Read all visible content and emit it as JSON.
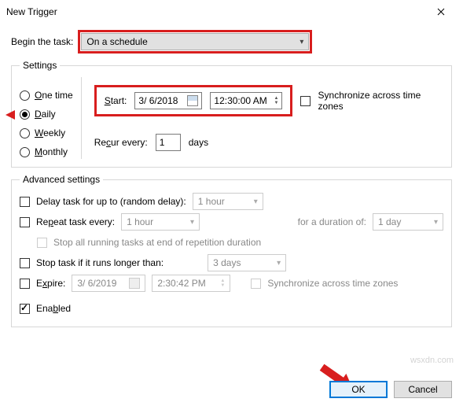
{
  "titlebar": {
    "title": "New Trigger"
  },
  "begin": {
    "label": "Begin the task:",
    "selected": "On a schedule"
  },
  "settings": {
    "legend": "Settings",
    "freq": {
      "onetime": "One time",
      "daily": "Daily",
      "weekly": "Weekly",
      "monthly": "Monthly",
      "selected": "daily"
    },
    "start": {
      "label": "Start:",
      "date": "3/ 6/2018",
      "time": "12:30:00 AM"
    },
    "sync": "Synchronize across time zones",
    "recur": {
      "label": "Recur every:",
      "value": "1",
      "unit": "days"
    }
  },
  "advanced": {
    "legend": "Advanced settings",
    "delay": {
      "label": "Delay task for up to (random delay):",
      "value": "1 hour"
    },
    "repeat": {
      "label": "Repeat task every:",
      "value": "1 hour",
      "duration_label": "for a duration of:",
      "duration": "1 day"
    },
    "stopall": "Stop all running tasks at end of repetition duration",
    "stoplong": {
      "label": "Stop task if it runs longer than:",
      "value": "3 days"
    },
    "expire": {
      "label": "Expire:",
      "date": "3/ 6/2019",
      "time": "2:30:42 PM",
      "sync": "Synchronize across time zones"
    },
    "enabled": "Enabled"
  },
  "buttons": {
    "ok": "OK",
    "cancel": "Cancel"
  },
  "watermark": "wsxdn.com"
}
